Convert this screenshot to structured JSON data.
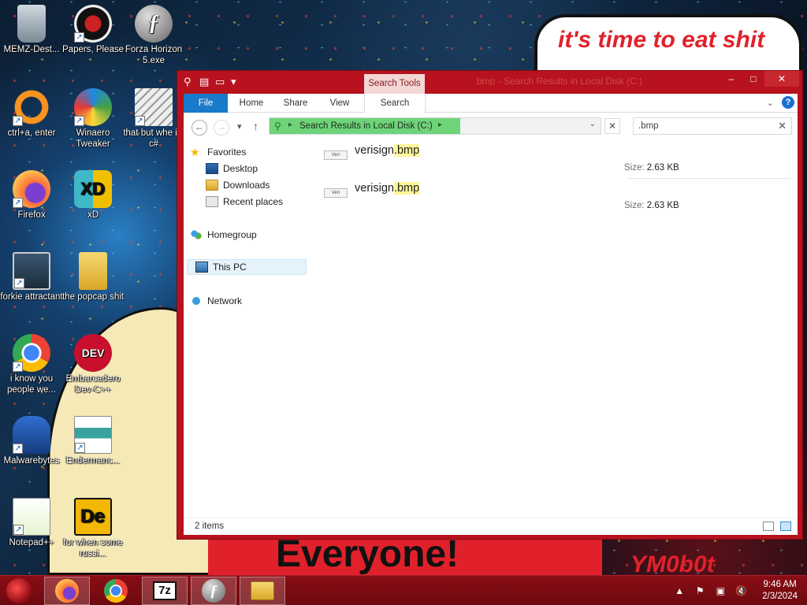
{
  "wallpaper": {
    "bubble_text": "it's time to eat shit",
    "banner_text": "Everyone!",
    "corner_text": "YM0b0t"
  },
  "desktop_icons": [
    {
      "label": "MEMZ-Dest...",
      "icon": "recycle-bin-icon"
    },
    {
      "label": "Papers, Please",
      "icon": "papers-please-icon"
    },
    {
      "label": "Forza Horizon 5.exe",
      "icon": "flash-icon"
    },
    {
      "label": "ctrl+a, enter",
      "icon": "ring-icon"
    },
    {
      "label": "Winaero Tweaker",
      "icon": "winaero-icon"
    },
    {
      "label": "that but whe its c#",
      "icon": "stacked-windows-icon"
    },
    {
      "label": "Firefox",
      "icon": "firefox-icon"
    },
    {
      "label": "xD",
      "icon": "hd-icon"
    },
    {
      "label": "forkie attractant",
      "icon": "monitor-gear-icon"
    },
    {
      "label": "the popcap shit",
      "icon": "folder-icon"
    },
    {
      "label": "i know you people we...",
      "icon": "chrome-icon"
    },
    {
      "label": "Embarcadero Dev-C++",
      "icon": "devcpp-icon"
    },
    {
      "label": "Malwarebytes",
      "icon": "malwarebytes-icon"
    },
    {
      "label": "Endermanc...",
      "icon": "document-window-icon"
    },
    {
      "label": "Notepad++",
      "icon": "notepad-plus-icon"
    },
    {
      "label": "for when some russi...",
      "icon": "de-icon"
    }
  ],
  "window": {
    "title": "bmp - Search Results in Local Disk (C:)",
    "contextual_tab": "Search Tools",
    "ribbon_tabs": [
      "File",
      "Home",
      "Share",
      "View",
      "Search"
    ],
    "address": {
      "text": "Search Results in Local Disk (C:)"
    },
    "search": {
      "value": ".bmp"
    },
    "nav_pane": {
      "favorites": "Favorites",
      "favorites_items": [
        "Desktop",
        "Downloads",
        "Recent places"
      ],
      "homegroup": "Homegroup",
      "this_pc": "This PC",
      "network": "Network"
    },
    "files": [
      {
        "name_base": "verisign",
        "name_ext": ".bmp",
        "size_label": "Size:",
        "size_value": "2.63 KB"
      },
      {
        "name_base": "verisign",
        "name_ext": ".bmp",
        "size_label": "Size:",
        "size_value": "2.63 KB"
      }
    ],
    "status": "2 items"
  },
  "taskbar": {
    "apps": [
      "firefox-icon",
      "chrome-icon",
      "7zip-icon",
      "flash-icon",
      "file-explorer-icon"
    ],
    "time": "9:46 AM",
    "date": "2/3/2024"
  },
  "colors": {
    "accent": "#b7121d",
    "file_tab": "#1979ca",
    "progress": "#6fd37a",
    "highlight": "#fff59a"
  }
}
